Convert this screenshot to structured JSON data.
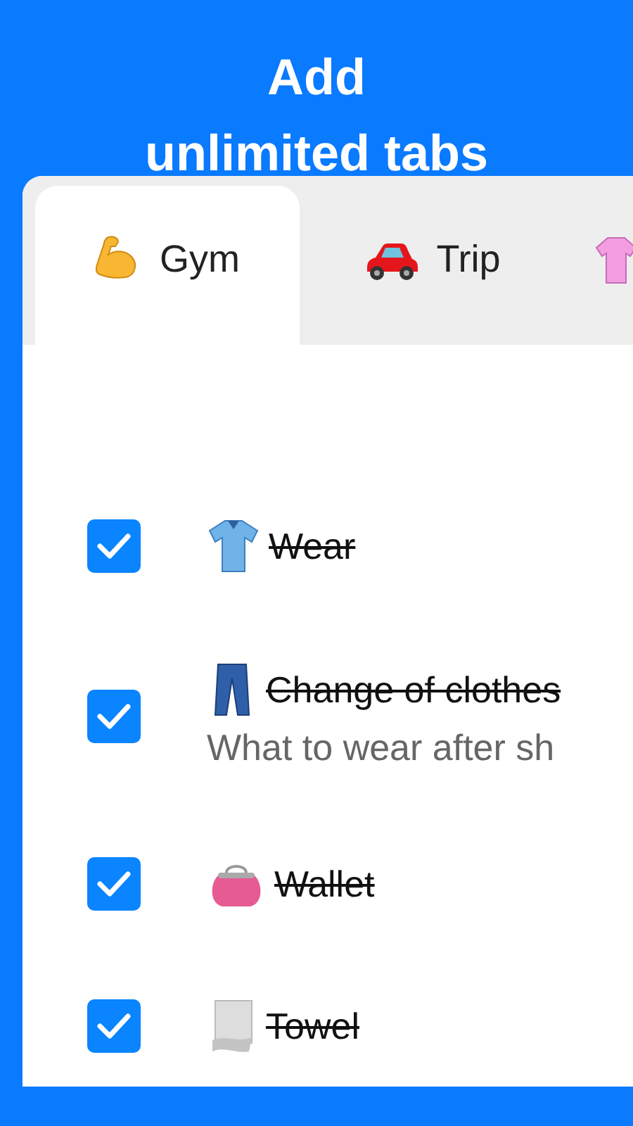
{
  "headline": {
    "lines": [
      "Add",
      "unlimited tabs"
    ]
  },
  "tabs": [
    {
      "label": "Gym",
      "selected": true
    },
    {
      "label": "Trip",
      "selected": false
    },
    {
      "selected": false
    }
  ],
  "items": [
    {
      "title": "Wear",
      "checked": true
    },
    {
      "title": "Change of clothes",
      "note": "What to wear after sh",
      "checked": true
    },
    {
      "title": "Wallet",
      "checked": true
    },
    {
      "title": "Towel",
      "checked": true
    }
  ]
}
